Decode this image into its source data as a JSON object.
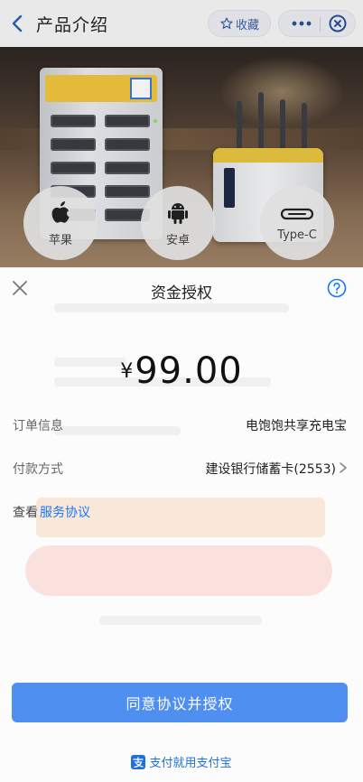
{
  "header": {
    "title": "产品介绍",
    "favorite_label": "收藏"
  },
  "options": [
    {
      "label": "苹果",
      "icon": "apple-icon"
    },
    {
      "label": "安卓",
      "icon": "android-icon"
    },
    {
      "label": "Type-C",
      "icon": "usb-c-icon"
    }
  ],
  "sheet": {
    "title": "资金授权",
    "currency": "¥",
    "amount": "99.00",
    "order_label": "订单信息",
    "order_value": "电饱饱共享充电宝",
    "payment_label": "付款方式",
    "payment_value": "建设银行储蓄卡(2553)",
    "terms_prefix": "查看",
    "terms_link": "服务协议",
    "agree_button": "同意协议并授权",
    "footer_text": "支付就用支付宝"
  },
  "colors": {
    "accent": "#1677ff",
    "button": "#4f8ff0",
    "header_bg": "#f6f6f6"
  }
}
